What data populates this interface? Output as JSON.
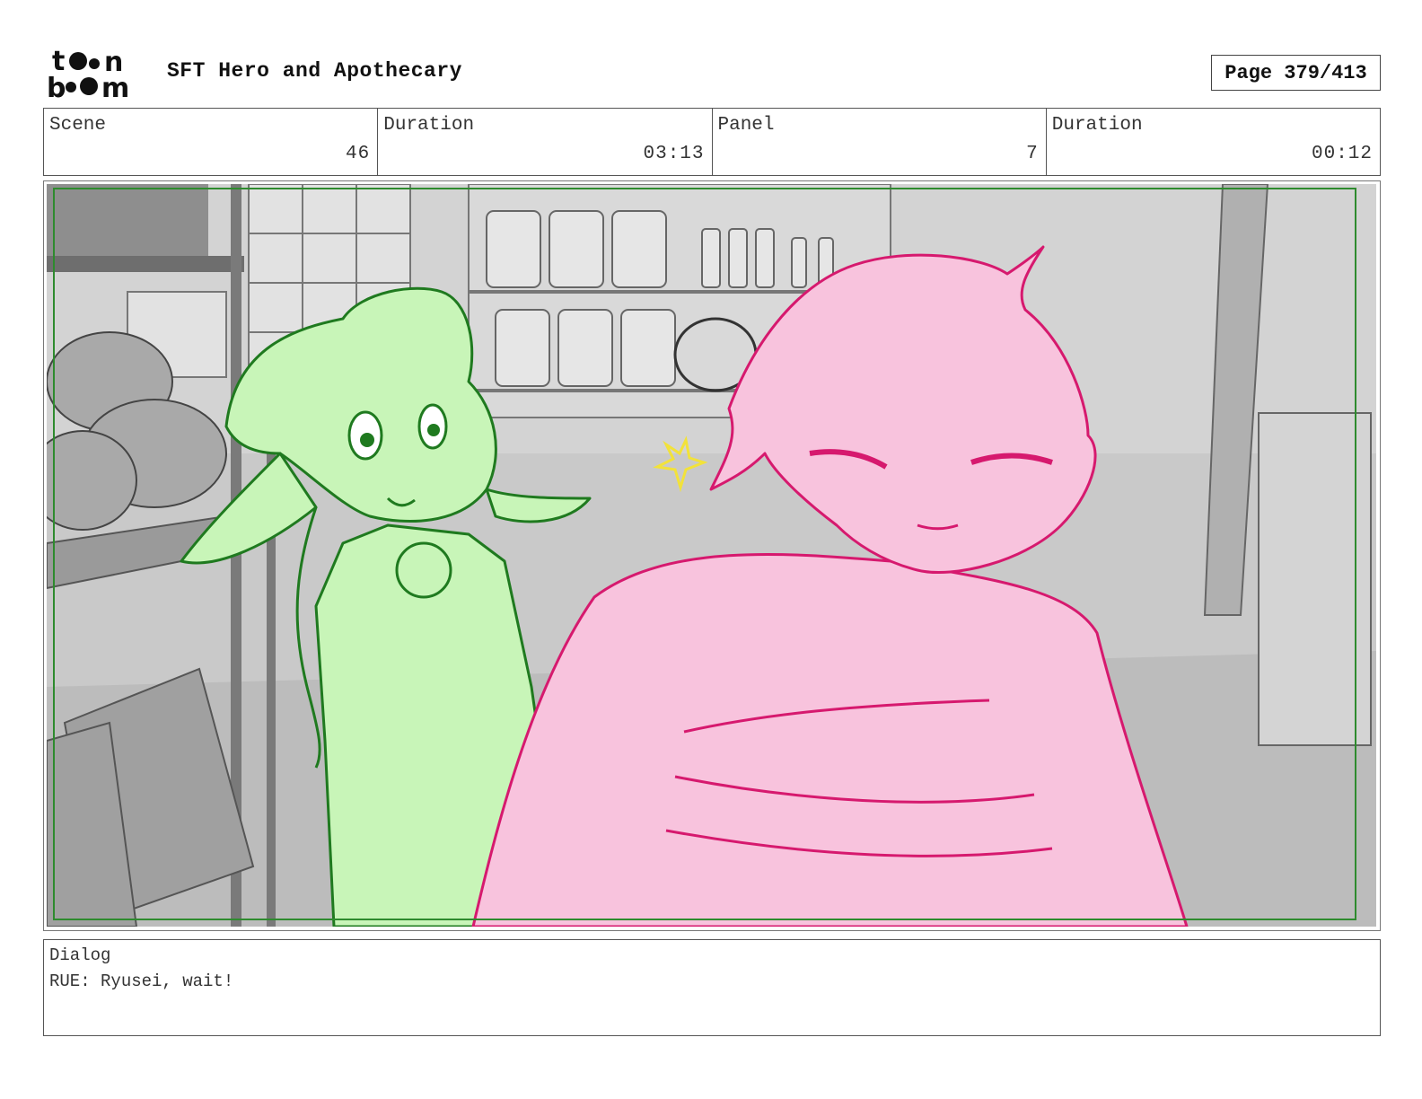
{
  "header": {
    "logo_text": "toon boom",
    "project_title": "SFT Hero and Apothecary",
    "page_label": "Page 379/413"
  },
  "info": {
    "scene_label": "Scene",
    "scene_value": "46",
    "scene_duration_label": "Duration",
    "scene_duration_value": "03:13",
    "panel_label": "Panel",
    "panel_value": "7",
    "panel_duration_label": "Duration",
    "panel_duration_value": "00:12"
  },
  "dialog": {
    "label": "Dialog",
    "text": "RUE: Ryusei, wait!"
  },
  "colors": {
    "safe_frame": "#2e8b2e",
    "rue_fill": "#c8f5b8",
    "rue_line": "#1f7a1f",
    "ryusei_fill": "#f8c3dd",
    "ryusei_line": "#d6196e",
    "shock_mark": "#f2e23a",
    "background_gray": "#c4c4c4"
  }
}
